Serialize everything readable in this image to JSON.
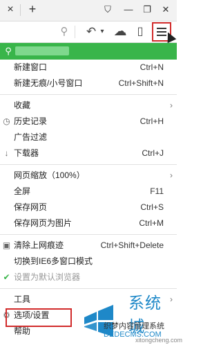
{
  "titlebar": {
    "close_tab_glyph": "×",
    "new_tab_glyph": "+",
    "win_shirt_glyph": "⛉",
    "win_min_glyph": "—",
    "win_restore_glyph": "❐",
    "win_close_glyph": "✕"
  },
  "toolbar": {
    "search_glyph": "⚲",
    "undo_glyph": "↶",
    "undo_drop_glyph": "▾",
    "cloud_glyph": "☁",
    "phone_glyph": "▯"
  },
  "user": {
    "icon": "user-icon",
    "icon_glyph": "⚲"
  },
  "menu": {
    "items": [
      {
        "label": "新建窗口",
        "shortcut": "Ctrl+N"
      },
      {
        "label": "新建无痕/小号窗口",
        "shortcut": "Ctrl+Shift+N"
      },
      {
        "label": "收藏",
        "arrow": "›"
      },
      {
        "label": "历史记录",
        "shortcut": "Ctrl+H",
        "icon_glyph": "◷"
      },
      {
        "label": "广告过滤"
      },
      {
        "label": "下载器",
        "shortcut": "Ctrl+J",
        "icon_glyph": "↓"
      },
      {
        "label": "网页缩放（100%）",
        "arrow": "›"
      },
      {
        "label": "全屏",
        "shortcut": "F11"
      },
      {
        "label": "保存网页",
        "shortcut": "Ctrl+S"
      },
      {
        "label": "保存网页为图片",
        "shortcut": "Ctrl+M"
      },
      {
        "label": "清除上网痕迹",
        "shortcut": "Ctrl+Shift+Delete",
        "icon_glyph": "▣"
      },
      {
        "label": "切换到IE6多窗口模式"
      },
      {
        "label": "设置为默认浏览器",
        "icon_glyph": "✔"
      },
      {
        "label": "工具",
        "arrow": "›"
      },
      {
        "label": "选项/设置",
        "icon_glyph": "⚙"
      },
      {
        "label": "帮助"
      }
    ]
  },
  "watermark": {
    "big": "系统城",
    "line1": "织梦内容管理系统",
    "line2": "DEDECMS.COM",
    "line3": "xitongcheng.com"
  },
  "colors": {
    "accent_green": "#39b54a",
    "highlight_red": "#d12a2a",
    "watermark_blue": "#1e88c8"
  }
}
